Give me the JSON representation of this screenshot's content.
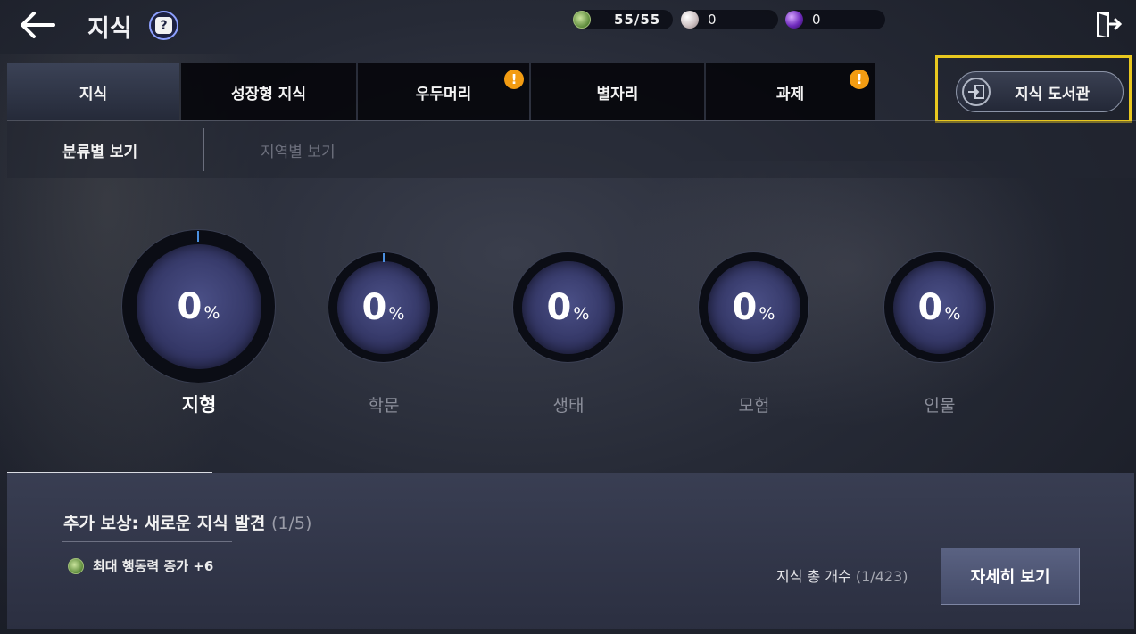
{
  "header": {
    "title": "지식",
    "resources": [
      {
        "icon": "energy-icon",
        "value": "55/55"
      },
      {
        "icon": "pearl-icon",
        "value": "0"
      },
      {
        "icon": "purple-orb-icon",
        "value": "0"
      }
    ]
  },
  "tabs": [
    {
      "label": "지식",
      "active": true,
      "alert": false
    },
    {
      "label": "성장형 지식",
      "active": false,
      "alert": false
    },
    {
      "label": "우두머리",
      "active": false,
      "alert": true
    },
    {
      "label": "별자리",
      "active": false,
      "alert": false
    },
    {
      "label": "과제",
      "active": false,
      "alert": true
    }
  ],
  "alert_symbol": "!",
  "library_button": {
    "label": "지식 도서관"
  },
  "subtabs": [
    {
      "label": "분류별 보기",
      "active": true
    },
    {
      "label": "지역별 보기",
      "active": false
    }
  ],
  "categories": [
    {
      "label": "지형",
      "percent": "0",
      "unit": "%",
      "selected": true
    },
    {
      "label": "학문",
      "percent": "0",
      "unit": "%",
      "selected": false
    },
    {
      "label": "생태",
      "percent": "0",
      "unit": "%",
      "selected": false
    },
    {
      "label": "모험",
      "percent": "0",
      "unit": "%",
      "selected": false
    },
    {
      "label": "인물",
      "percent": "0",
      "unit": "%",
      "selected": false
    }
  ],
  "reward": {
    "title": "추가 보상: 새로운 지식 발견",
    "count": "(1/5)",
    "item": "최대 행동력 증가 +6"
  },
  "total": {
    "label": "지식 총 개수",
    "count": "(1/423)"
  },
  "detail_button": {
    "label": "자세히 보기"
  },
  "colors": {
    "highlight": "#e9c81f",
    "alert": "#f39c12",
    "progress_tick": "#4a8fe0"
  }
}
